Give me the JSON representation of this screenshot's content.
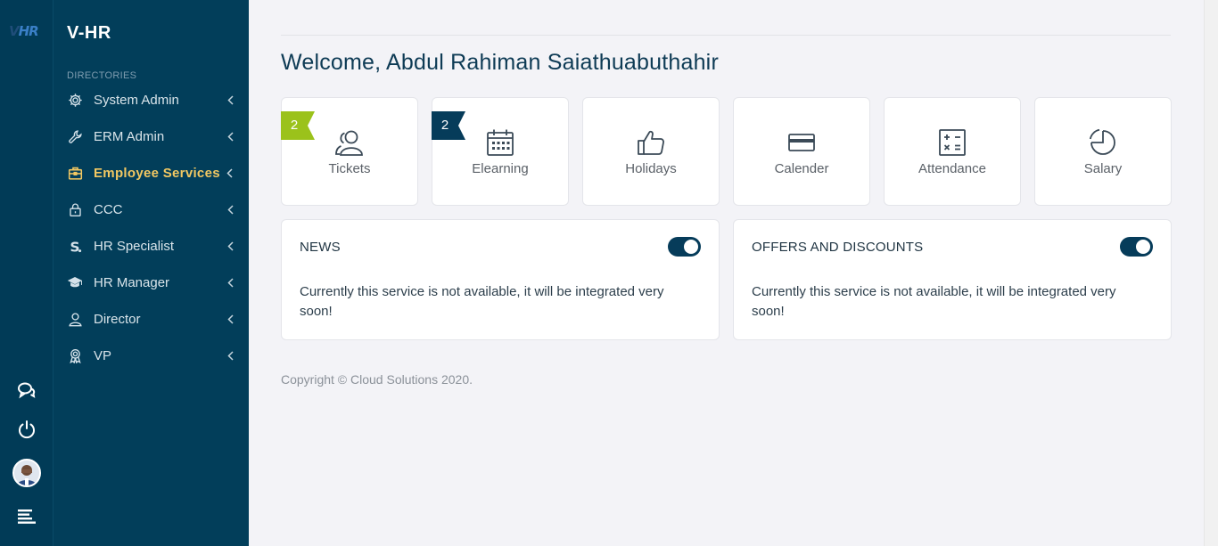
{
  "rail": {
    "logo_v": "V",
    "logo_hr": "HR",
    "buttons": [
      {
        "icon": "chat-icon"
      },
      {
        "icon": "power-icon"
      },
      {
        "icon": "avatar"
      },
      {
        "icon": "menu-lines-icon"
      }
    ]
  },
  "sidebar": {
    "brand": "V-HR",
    "section_label": "DIRECTORIES",
    "items": [
      {
        "label": "System Admin",
        "icon": "gear-icon"
      },
      {
        "label": "ERM Admin",
        "icon": "wrench-icon"
      },
      {
        "label": "Employee Services",
        "icon": "briefcase-icon",
        "active": true
      },
      {
        "label": "CCC",
        "icon": "lock-icon"
      },
      {
        "label": "HR Specialist",
        "icon": "dollar-s-icon"
      },
      {
        "label": "HR Manager",
        "icon": "graduation-cap-icon"
      },
      {
        "label": "Director",
        "icon": "user-icon"
      },
      {
        "label": "VP",
        "icon": "award-icon"
      }
    ]
  },
  "main": {
    "welcome": "Welcome, Abdul Rahiman Saiathuabuthahir",
    "tiles": [
      {
        "label": "Tickets",
        "icon": "users-icon",
        "badge": "2",
        "badge_color": "#9bc21b"
      },
      {
        "label": "Elearning",
        "icon": "calendar-grid-icon",
        "badge": "2",
        "badge_color": "#063c5a"
      },
      {
        "label": "Holidays",
        "icon": "thumbs-up-icon"
      },
      {
        "label": "Calender",
        "icon": "credit-card-icon"
      },
      {
        "label": "Attendance",
        "icon": "calculator-icon"
      },
      {
        "label": "Salary",
        "icon": "pie-chart-icon"
      }
    ],
    "panels": [
      {
        "title": "NEWS",
        "text": "Currently this service is not available, it will be integrated very soon!",
        "toggle_on": true
      },
      {
        "title": "OFFERS AND DISCOUNTS",
        "text": "Currently this service is not available, it will be integrated very soon!",
        "toggle_on": true
      }
    ],
    "copyright": "Copyright © Cloud Solutions 2020."
  },
  "colors": {
    "sidebar_bg": "#023e5a",
    "active_item": "#f2c862",
    "accent_dark": "#063c5a",
    "badge_green": "#9bc21b"
  }
}
